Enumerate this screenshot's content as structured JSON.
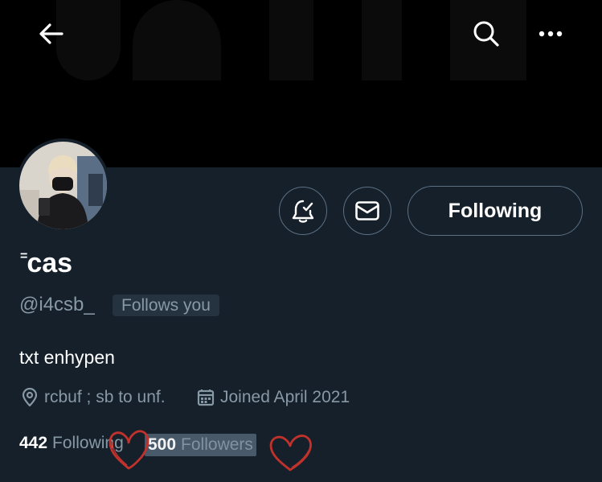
{
  "header": {
    "back_icon": "arrow-left-icon",
    "search_icon": "search-icon",
    "more_icon": "more-horizontal-icon"
  },
  "profile": {
    "name": "cas",
    "name_mark": "=",
    "handle": "@i4csb_",
    "follows_you": "Follows you",
    "bio": "txt enhypen",
    "location": "rcbuf ; sb to unf.",
    "joined": "Joined April 2021"
  },
  "actions": {
    "notify_icon": "bell-check-icon",
    "message_icon": "mail-icon",
    "following_label": "Following"
  },
  "stats": {
    "following_count": "442",
    "following_label": "Following",
    "followers_count": "500",
    "followers_label": "Followers"
  },
  "colors": {
    "background": "#15202b",
    "secondary_text": "#8899a6",
    "border": "#5b7083",
    "heart_doodle": "#c0322b"
  }
}
